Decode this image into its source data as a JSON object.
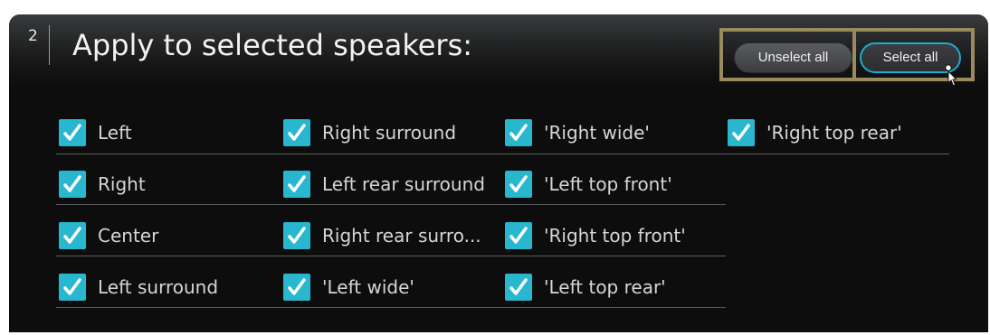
{
  "header": {
    "step_number": "2",
    "title": "Apply to selected speakers:",
    "unselect_all_label": "Unselect all",
    "select_all_label": "Select all"
  },
  "speakers": [
    {
      "label": "Left",
      "checked": true
    },
    {
      "label": "Right surround",
      "checked": true
    },
    {
      "label": "'Right wide'",
      "checked": true
    },
    {
      "label": "'Right top rear'",
      "checked": true
    },
    {
      "label": "Right",
      "checked": true
    },
    {
      "label": "Left rear surround",
      "checked": true
    },
    {
      "label": "'Left top front'",
      "checked": true
    },
    {
      "label": "Center",
      "checked": true
    },
    {
      "label": "Right rear surro...",
      "checked": true
    },
    {
      "label": "'Right top front'",
      "checked": true
    },
    {
      "label": "Left surround",
      "checked": true
    },
    {
      "label": "'Left wide'",
      "checked": true
    },
    {
      "label": "'Left top rear'",
      "checked": true
    }
  ],
  "colors": {
    "checkbox_fill": "#29b7cf",
    "highlight_border": "#9c8a5f",
    "select_all_border": "#1aaed0",
    "panel_background": "#0d0d0e"
  },
  "icons": {
    "checkmark": "checkmark-icon",
    "cursor": "mouse-pointer-icon"
  }
}
